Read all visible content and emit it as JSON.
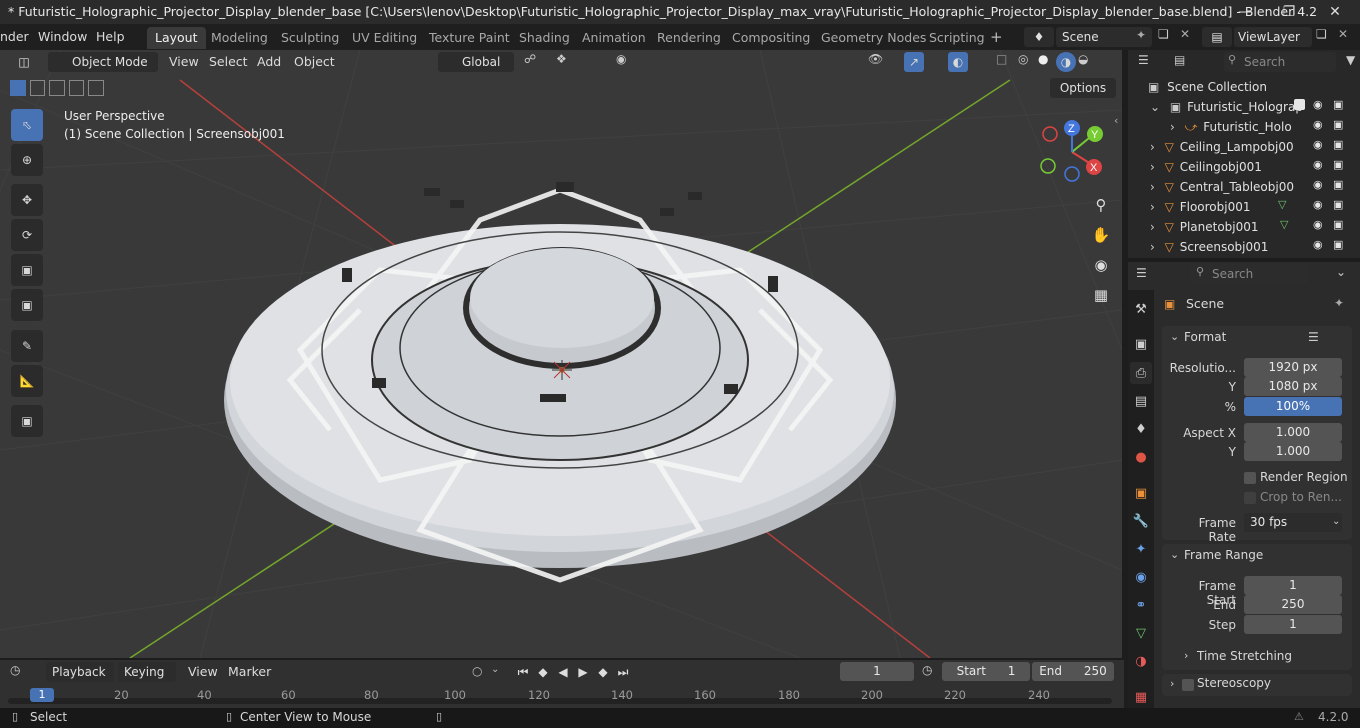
{
  "titlebar": {
    "title": "* Futuristic_Holographic_Projector_Display_blender_base [C:\\Users\\lenov\\Desktop\\Futuristic_Holographic_Projector_Display_max_vray\\Futuristic_Holographic_Projector_Display_blender_base.blend] - Blender 4.2"
  },
  "menu": {
    "file": "nder",
    "window": "Window",
    "help": "Help"
  },
  "workspaces": [
    "Layout",
    "Modeling",
    "Sculpting",
    "UV Editing",
    "Texture Paint",
    "Shading",
    "Animation",
    "Rendering",
    "Compositing",
    "Geometry Nodes",
    "Scripting"
  ],
  "active_workspace": "Layout",
  "scene_selector": {
    "value": "Scene"
  },
  "viewlayer_selector": {
    "value": "ViewLayer"
  },
  "viewport": {
    "mode": "Object Mode",
    "menus": {
      "view": "View",
      "select": "Select",
      "add": "Add",
      "object": "Object"
    },
    "transform_orientation": "Global",
    "options_label": "Options",
    "overlay_line1": "User Perspective",
    "overlay_line2": "(1) Scene Collection | Screensobj001",
    "gizmo": {
      "x": "X",
      "y": "Y",
      "z": "Z"
    },
    "colors": {
      "grid_x": "#b6403b",
      "grid_y": "#74a62b",
      "bg": "#393939"
    }
  },
  "outliner": {
    "search_placeholder": "Search",
    "root": "Scene Collection",
    "items": [
      {
        "label": "Futuristic_Holograp"
      },
      {
        "label": "Futuristic_Holo"
      },
      {
        "label": "Ceiling_Lampobj00"
      },
      {
        "label": "Ceilingobj001"
      },
      {
        "label": "Central_Tableobj00"
      },
      {
        "label": "Floorobj001"
      },
      {
        "label": "Planetobj001"
      },
      {
        "label": "Screensobj001"
      }
    ]
  },
  "properties": {
    "search_placeholder": "Search",
    "context": "Scene",
    "format": {
      "title": "Format",
      "res_label": "Resolutio...",
      "res_x": "1920 px",
      "y_label": "Y",
      "res_y": "1080 px",
      "pct_label": "%",
      "pct": "100%",
      "aspect_label": "Aspect X",
      "aspect_x": "1.000",
      "aspect_y_label": "Y",
      "aspect_y": "1.000",
      "render_region": "Render Region",
      "crop": "Crop to Ren...",
      "frame_rate_label": "Frame Rate",
      "frame_rate": "30 fps"
    },
    "frame_range": {
      "title": "Frame Range",
      "start_label": "Frame Start",
      "start": "1",
      "end_label": "End",
      "end": "250",
      "step_label": "Step",
      "step": "1"
    },
    "time_stretching": "Time Stretching",
    "stereoscopy": "Stereoscopy"
  },
  "timeline": {
    "menus": {
      "playback": "Playback",
      "keying": "Keying",
      "view": "View",
      "marker": "Marker"
    },
    "current_frame": "1",
    "start_label": "Start",
    "start": "1",
    "end_label": "End",
    "end": "250",
    "ticks": [
      "1",
      "20",
      "40",
      "60",
      "80",
      "100",
      "120",
      "140",
      "160",
      "180",
      "200",
      "220",
      "240"
    ]
  },
  "statusbar": {
    "select": "Select",
    "center": "Center View to Mouse",
    "version": "4.2.0"
  }
}
